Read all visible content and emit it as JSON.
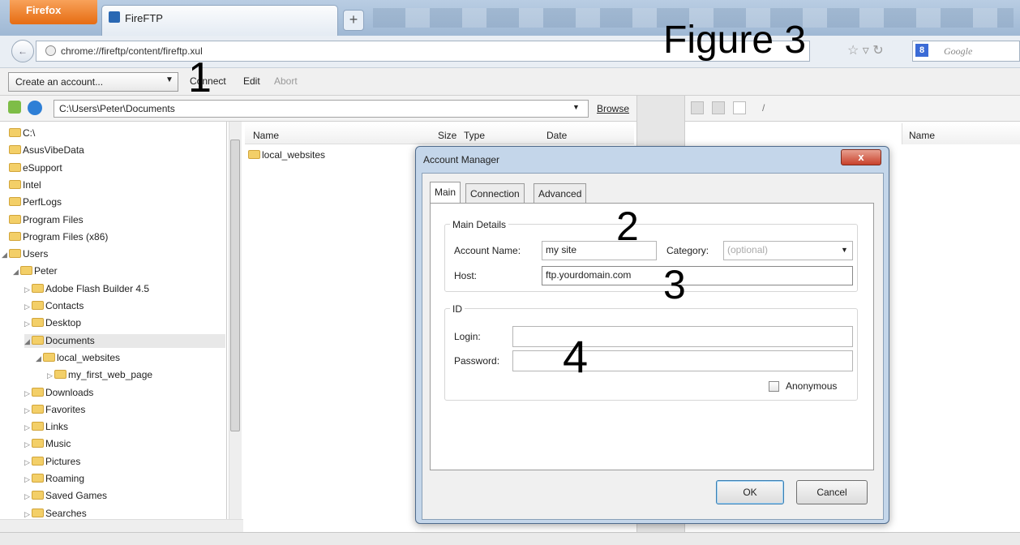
{
  "browser": {
    "firefox_button": "Firefox",
    "tab_title": "FireFTP",
    "new_tab": "+",
    "url": "chrome://fireftp/content/fireftp.xul",
    "search_placeholder": "Google",
    "search_engine_glyph": "8"
  },
  "annotations": {
    "figure_label": "Figure 3",
    "n1": "1",
    "n2": "2",
    "n3": "3",
    "n4": "4"
  },
  "toolbar": {
    "account_select": "Create an account...",
    "connect": "Connect",
    "edit": "Edit",
    "abort": "Abort"
  },
  "local": {
    "path": "C:\\Users\\Peter\\Documents",
    "browse": "Browse",
    "columns": {
      "name": "Name",
      "size": "Size",
      "type": "Type",
      "date": "Date"
    },
    "files": [
      "local_websites"
    ]
  },
  "remote": {
    "path": "/",
    "column_name": "Name"
  },
  "tree": [
    {
      "label": "C:\\",
      "depth": 0,
      "tw": ""
    },
    {
      "label": "AsusVibeData",
      "depth": 0,
      "tw": ""
    },
    {
      "label": "eSupport",
      "depth": 0,
      "tw": ""
    },
    {
      "label": "Intel",
      "depth": 0,
      "tw": ""
    },
    {
      "label": "PerfLogs",
      "depth": 0,
      "tw": ""
    },
    {
      "label": "Program Files",
      "depth": 0,
      "tw": ""
    },
    {
      "label": "Program Files (x86)",
      "depth": 0,
      "tw": ""
    },
    {
      "label": "Users",
      "depth": 0,
      "tw": "◢"
    },
    {
      "label": "Peter",
      "depth": 1,
      "tw": "◢"
    },
    {
      "label": "Adobe Flash Builder 4.5",
      "depth": 2,
      "tw": "▷"
    },
    {
      "label": "Contacts",
      "depth": 2,
      "tw": "▷"
    },
    {
      "label": "Desktop",
      "depth": 2,
      "tw": "▷"
    },
    {
      "label": "Documents",
      "depth": 2,
      "tw": "◢"
    },
    {
      "label": "local_websites",
      "depth": 3,
      "tw": "◢"
    },
    {
      "label": "my_first_web_page",
      "depth": 4,
      "tw": "▷"
    },
    {
      "label": "Downloads",
      "depth": 2,
      "tw": "▷"
    },
    {
      "label": "Favorites",
      "depth": 2,
      "tw": "▷"
    },
    {
      "label": "Links",
      "depth": 2,
      "tw": "▷"
    },
    {
      "label": "Music",
      "depth": 2,
      "tw": "▷"
    },
    {
      "label": "Pictures",
      "depth": 2,
      "tw": "▷"
    },
    {
      "label": "Roaming",
      "depth": 2,
      "tw": "▷"
    },
    {
      "label": "Saved Games",
      "depth": 2,
      "tw": "▷"
    },
    {
      "label": "Searches",
      "depth": 2,
      "tw": "▷"
    }
  ],
  "dialog": {
    "title": "Account Manager",
    "close": "x",
    "tabs": {
      "main": "Main",
      "connection": "Connection",
      "advanced": "Advanced"
    },
    "main_details": "Main Details",
    "account_name_label": "Account Name:",
    "account_name_value": "my site",
    "category_label": "Category:",
    "category_placeholder": "(optional)",
    "host_label": "Host:",
    "host_value": "ftp.yourdomain.com",
    "id_group": "ID",
    "login_label": "Login:",
    "login_value": "",
    "password_label": "Password:",
    "password_value": "",
    "anonymous_label": "Anonymous",
    "anonymous_checked": false,
    "ok": "OK",
    "cancel": "Cancel"
  }
}
